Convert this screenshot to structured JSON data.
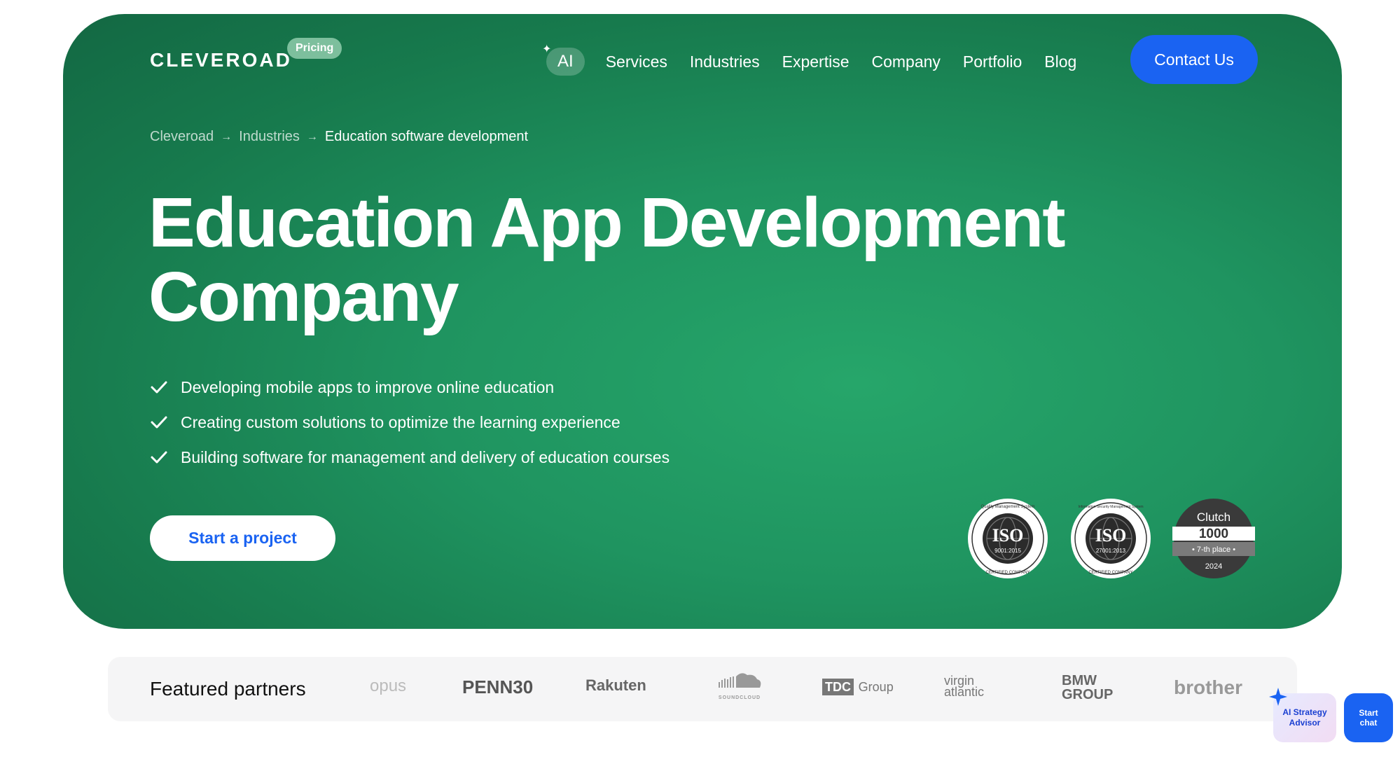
{
  "header": {
    "logo": "CLEVEROAD",
    "pricing_badge": "Pricing",
    "nav": {
      "ai": "AI",
      "items": [
        "Services",
        "Industries",
        "Expertise",
        "Company",
        "Portfolio",
        "Blog"
      ]
    },
    "contact_label": "Contact Us"
  },
  "breadcrumb": {
    "items": [
      "Cleveroad",
      "Industries"
    ],
    "current": "Education software development"
  },
  "hero": {
    "title_line1": "Education App Development",
    "title_line2": "Company",
    "bullets": [
      "Developing mobile apps to improve online education",
      "Creating custom solutions to optimize the learning experience",
      "Building software for management and delivery of education courses"
    ],
    "start_label": "Start a project"
  },
  "badges": {
    "iso1": {
      "top": "Quality Management System",
      "main": "ISO",
      "code": "9001:2015",
      "bottom": "CERTIFIED COMPANY"
    },
    "iso2": {
      "top": "Information Security Management System",
      "main": "ISO",
      "code": "27001:2013",
      "bottom": "CERTIFIED COMPANY"
    },
    "clutch": {
      "brand": "Clutch",
      "number": "1000",
      "place": "• 7-th place •",
      "year": "2024"
    }
  },
  "partners": {
    "title": "Featured partners",
    "logos": [
      "opus",
      "PENN30",
      "Rakuten",
      "SOUNDCLOUD",
      "TDC",
      "Group",
      "virgin atlantic",
      "BMW GROUP",
      "brother"
    ]
  },
  "widgets": {
    "advisor_label": "AI Strategy Advisor",
    "chat_label": "Start chat"
  },
  "colors": {
    "accent_blue": "#1a63f2",
    "hero_green": "#1f9460"
  }
}
